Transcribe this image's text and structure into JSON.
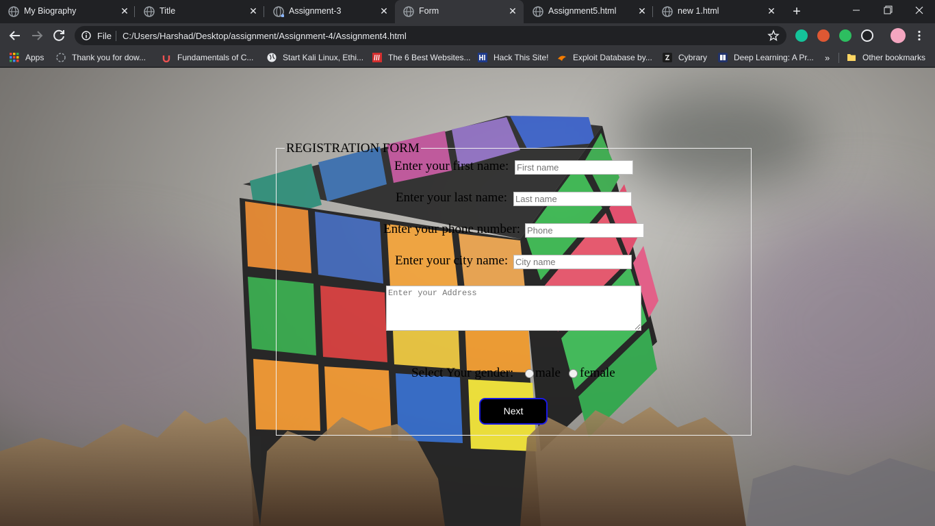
{
  "tabs": [
    {
      "title": "My Biography",
      "active": false
    },
    {
      "title": "Title",
      "active": false
    },
    {
      "title": "Assignment-3",
      "active": false
    },
    {
      "title": "Form",
      "active": true
    },
    {
      "title": "Assignment5.html",
      "active": false
    },
    {
      "title": "new 1.html",
      "active": false
    }
  ],
  "toolbar": {
    "file_label": "File",
    "url": "C:/Users/Harshad/Desktop/assignment/Assignment-4/Assignment4.html"
  },
  "bookmarks": [
    {
      "label": "Apps",
      "icon": "apps-grid-icon"
    },
    {
      "label": "Thank you for dow...",
      "icon": "download-icon"
    },
    {
      "label": "Fundamentals of C...",
      "icon": "udemy-icon"
    },
    {
      "label": "Start Kali Linux, Ethi...",
      "icon": "globe-icon"
    },
    {
      "label": "The 6 Best Websites...",
      "icon": "m-icon"
    },
    {
      "label": "Hack This Site!",
      "icon": "hackthissite-icon"
    },
    {
      "label": "Exploit Database by...",
      "icon": "exploitdb-icon"
    },
    {
      "label": "Cybrary",
      "icon": "cybrary-icon"
    },
    {
      "label": "Deep Learning: A Pr...",
      "icon": "book-icon"
    }
  ],
  "other_bookmarks": "Other bookmarks",
  "form": {
    "legend": "REGISTRATION FORM",
    "first_name_label": "Enter your first name:",
    "first_name_placeholder": "First name",
    "last_name_label": "Enter your last name:",
    "last_name_placeholder": "Last name",
    "phone_label": "Enter your phone number:",
    "phone_placeholder": "Phone",
    "city_label": "Enter your city name:",
    "city_placeholder": "City name",
    "address_placeholder": "Enter your Address",
    "gender_label": "Select Your gender:",
    "gender_options": [
      "male",
      "female"
    ],
    "submit_label": "Next"
  },
  "colors": {
    "tab_strip": "#202124",
    "toolbar": "#35363a",
    "button_bg": "#000000",
    "button_border": "#1a1ae6"
  }
}
